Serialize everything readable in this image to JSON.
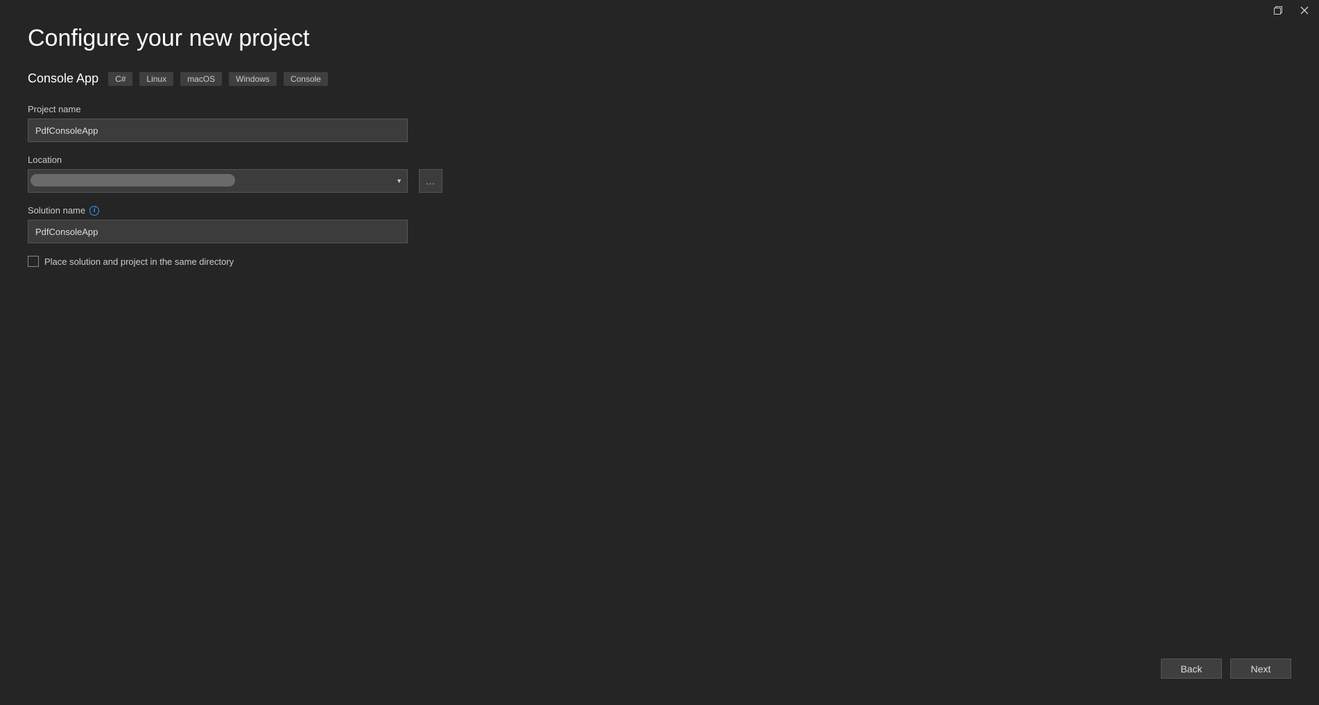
{
  "titlebar": {
    "maximize_icon": "maximize",
    "close_icon": "close"
  },
  "header": {
    "title": "Configure your new project",
    "template_name": "Console App",
    "tags": [
      "C#",
      "Linux",
      "macOS",
      "Windows",
      "Console"
    ]
  },
  "fields": {
    "project_name": {
      "label": "Project name",
      "value": "PdfConsoleApp"
    },
    "location": {
      "label": "Location",
      "value": "",
      "browse_label": "..."
    },
    "solution_name": {
      "label": "Solution name",
      "value": "PdfConsoleApp"
    },
    "same_directory": {
      "label": "Place solution and project in the same directory",
      "checked": false
    }
  },
  "footer": {
    "back": "Back",
    "next": "Next"
  }
}
